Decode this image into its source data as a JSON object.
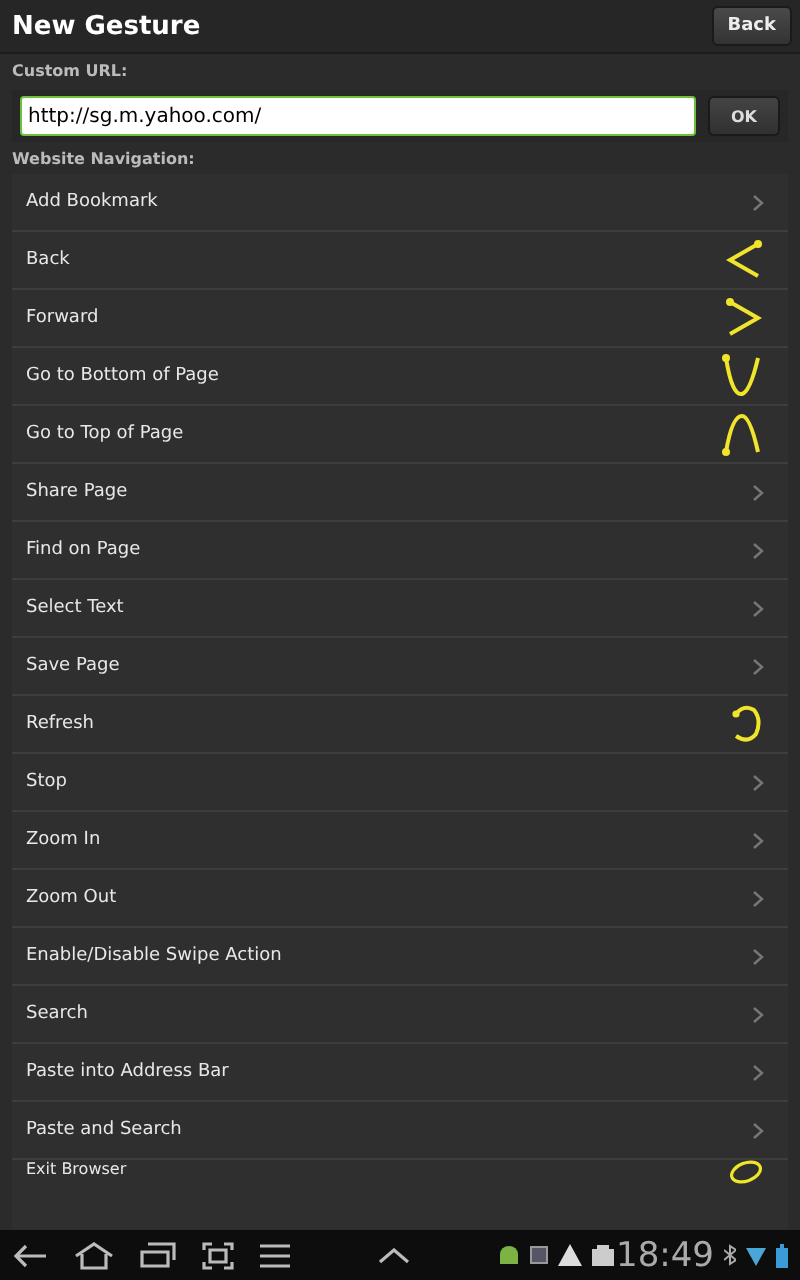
{
  "window": {
    "title": "New Gesture",
    "back_button": "Back"
  },
  "custom_url": {
    "label": "Custom URL:",
    "value": "http://sg.m.yahoo.com/",
    "button": "OK"
  },
  "navigation": {
    "label": "Website Navigation:",
    "items": [
      {
        "label": "Add Bookmark",
        "kind": "arrow"
      },
      {
        "label": "Back",
        "kind": "left"
      },
      {
        "label": "Forward",
        "kind": "right"
      },
      {
        "label": "Go to Bottom of Page",
        "kind": "down"
      },
      {
        "label": "Go to Top of Page",
        "kind": "up"
      },
      {
        "label": "Share Page",
        "kind": "arrow"
      },
      {
        "label": "Find on Page",
        "kind": "arrow"
      },
      {
        "label": "Select Text",
        "kind": "arrow"
      },
      {
        "label": "Save Page",
        "kind": "arrow"
      },
      {
        "label": "Refresh",
        "kind": "circle"
      },
      {
        "label": "Stop",
        "kind": "arrow"
      },
      {
        "label": "Zoom In",
        "kind": "arrow"
      },
      {
        "label": "Zoom Out",
        "kind": "arrow"
      },
      {
        "label": "Enable/Disable Swipe Action",
        "kind": "arrow"
      },
      {
        "label": "Search",
        "kind": "arrow"
      },
      {
        "label": "Paste into Address Bar",
        "kind": "arrow"
      },
      {
        "label": "Paste and Search",
        "kind": "arrow"
      },
      {
        "label": "Exit Browser",
        "kind": "oval"
      }
    ]
  },
  "status_bar": {
    "time": "18:49"
  }
}
